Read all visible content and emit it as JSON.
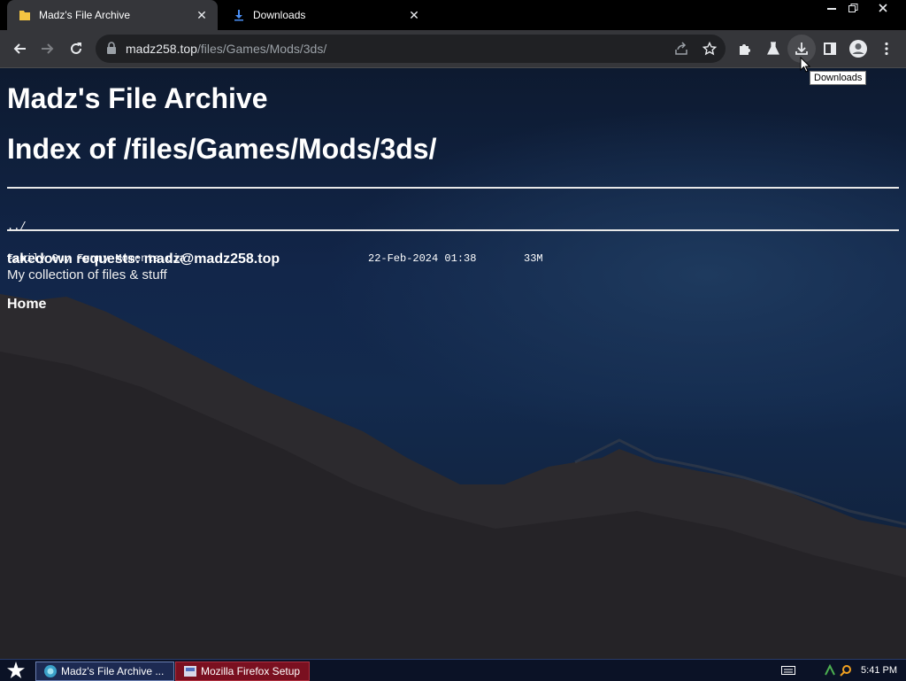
{
  "tabs": [
    {
      "title": "Madz's File Archive",
      "icon": "folder-icon",
      "active": true
    },
    {
      "title": "Downloads",
      "icon": "download-icon",
      "active": false
    }
  ],
  "window_controls": [
    "minimize",
    "restore",
    "close"
  ],
  "address": {
    "host": "madz258.top",
    "path": "/files/Games/Mods/3ds/"
  },
  "tooltip": "Downloads",
  "page": {
    "site_title": "Madz's File Archive",
    "index_title": "Index of /files/Games/Mods/3ds/",
    "listing": [
      {
        "name": "../",
        "date": "",
        "size": ""
      },
      {
        "name": "Family Guy Funny Moments.cia",
        "date": "22-Feb-2024 01:38",
        "size": "33M"
      }
    ],
    "takedown": "takedown requests: madz@madz258.top",
    "subtitle": "My collection of files & stuff",
    "home_link": "Home"
  },
  "taskbar": {
    "tasks": [
      {
        "label": "Madz's File Archive ...",
        "icon": "browser-icon"
      },
      {
        "label": "Mozilla Firefox Setup",
        "icon": "installer-icon"
      }
    ],
    "clock": "5:41 PM"
  },
  "colors": {
    "chrome_dark": "#000000",
    "toolbar": "#35363a",
    "omnibox": "#202124",
    "page_sky": "#12264a",
    "taskbar": "#0b1226",
    "task_highlight": "#7a1020"
  }
}
